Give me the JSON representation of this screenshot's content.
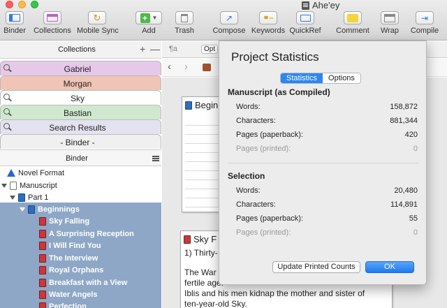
{
  "window": {
    "title": "Ahe'ey",
    "traffic_colors": [
      "#fc605c",
      "#fdbc40",
      "#34c84a"
    ]
  },
  "toolbar": {
    "buttons": [
      {
        "label": "Binder",
        "icon": "binder-icon"
      },
      {
        "label": "Collections",
        "icon": "collections-icon"
      },
      {
        "label": "Mobile Sync",
        "icon": "mobile-sync-icon"
      },
      {
        "label": "Add",
        "icon": "add-icon"
      },
      {
        "label": "Trash",
        "icon": "trash-icon"
      },
      {
        "label": "Compose",
        "icon": "compose-icon"
      },
      {
        "label": "Keywords",
        "icon": "keywords-icon"
      },
      {
        "label": "QuickRef",
        "icon": "quickref-icon"
      },
      {
        "label": "Comment",
        "icon": "comment-icon"
      },
      {
        "label": "Wrap",
        "icon": "wrap-icon"
      },
      {
        "label": "Compile",
        "icon": "compile-icon"
      }
    ]
  },
  "collections": {
    "title": "Collections",
    "plus": "+",
    "minus": "—",
    "tabs": [
      {
        "label": "Gabriel",
        "color": "#e6c8e8",
        "search": true
      },
      {
        "label": "Morgan",
        "color": "#f0c4b6",
        "search": false
      },
      {
        "label": "Sky",
        "color": "#ffffff",
        "search": true
      },
      {
        "label": "Bastian",
        "color": "#cfe8cf",
        "search": true
      },
      {
        "label": "Search Results",
        "color": "#e4e2f0",
        "search": true
      },
      {
        "label": "- Binder -",
        "color": "#f0f0f0",
        "search": false
      }
    ]
  },
  "binder": {
    "title": "Binder",
    "items": [
      {
        "label": "Novel Format",
        "icon": "warning-icon"
      },
      {
        "label": "Manuscript",
        "icon": "manuscript-icon"
      },
      {
        "label": "Part 1",
        "icon": "folder-icon"
      },
      {
        "label": "Beginnings",
        "icon": "folder-icon"
      },
      {
        "label": "Sky Falling",
        "icon": "document-icon"
      },
      {
        "label": "A Surprising Reception",
        "icon": "document-icon"
      },
      {
        "label": "I Will Find You",
        "icon": "document-icon"
      },
      {
        "label": "The Interview",
        "icon": "document-icon"
      },
      {
        "label": "Royal Orphans",
        "icon": "document-icon"
      },
      {
        "label": "Breakfast with a View",
        "icon": "document-icon"
      },
      {
        "label": "Water Angels",
        "icon": "document-icon"
      },
      {
        "label": "Perfection",
        "icon": "document-icon"
      }
    ]
  },
  "editor": {
    "format_label": "¶a",
    "options_short": "Opt",
    "card1_title": "Begin",
    "card2_title": "Sky F",
    "card2_line1": "1) Thirty-",
    "card2_line2": "The War",
    "card2_line3": "fertile age.",
    "card2_line4": "Iblis and his men kidnap the mother and sister of",
    "card2_line5": "ten-year-old Sky."
  },
  "dialog": {
    "title": "Project Statistics",
    "tabs": [
      "Statistics",
      "Options"
    ],
    "active_tab": "Statistics",
    "manuscript": {
      "title": "Manuscript (as Compiled)",
      "rows": [
        {
          "label": "Words:",
          "value": "158,872"
        },
        {
          "label": "Characters:",
          "value": "881,344"
        },
        {
          "label": "Pages (paperback):",
          "value": "420"
        },
        {
          "label": "Pages (printed):",
          "value": "0"
        }
      ]
    },
    "selection": {
      "title": "Selection",
      "rows": [
        {
          "label": "Words:",
          "value": "20,480"
        },
        {
          "label": "Characters:",
          "value": "114,891"
        },
        {
          "label": "Pages (paperback):",
          "value": "55"
        },
        {
          "label": "Pages (printed):",
          "value": "0"
        }
      ]
    },
    "update_button": "Update Printed Counts",
    "ok_button": "OK"
  }
}
